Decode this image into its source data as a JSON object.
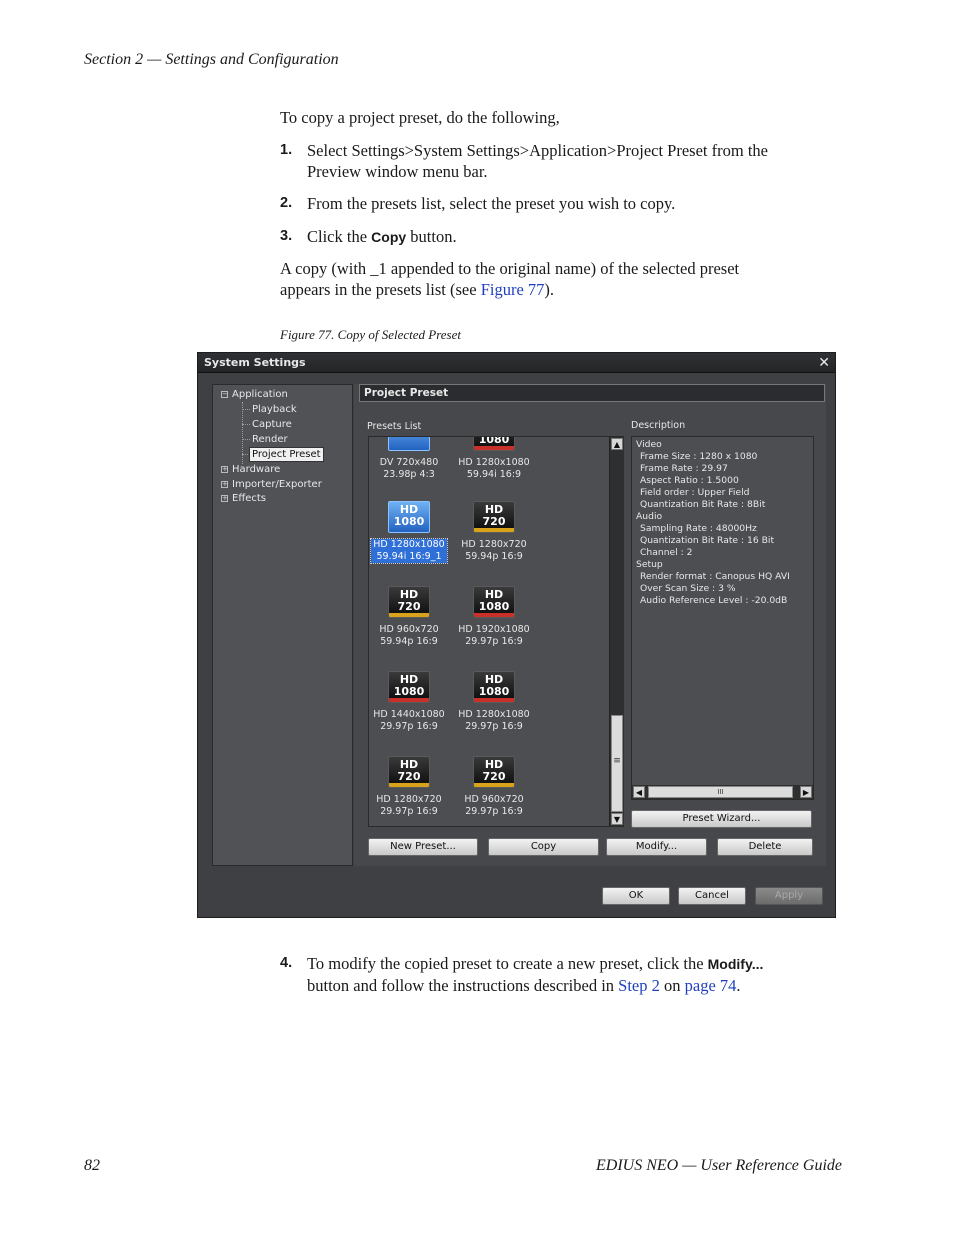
{
  "header": {
    "section": "Section 2 — Settings and Configuration"
  },
  "intro": "To copy a project preset, do the following,",
  "steps": [
    {
      "num": "1.",
      "line1": "Select Settings>System Settings>Application>Project Preset from the",
      "line2": "Preview window menu bar."
    },
    {
      "num": "2.",
      "line1": "From the presets list, select the preset you wish to copy."
    },
    {
      "num": "3.",
      "pre": "Click the ",
      "ui": "Copy",
      "post": " button."
    }
  ],
  "result": {
    "line1": "A copy (with _1 appended to the original name) of the selected preset",
    "line2_pre": "appears in the presets list (see ",
    "line2_link": "Figure 77",
    "line2_post": ")."
  },
  "figure_caption": "Figure 77.  Copy of Selected Preset",
  "dialog": {
    "title": "System Settings",
    "close": "✕",
    "tree": {
      "application": "Application",
      "children": [
        "Playback",
        "Capture",
        "Render",
        "Project Preset"
      ],
      "others": [
        "Hardware",
        "Importer/Exporter",
        "Effects"
      ],
      "collapse_glyph": "−",
      "expand_glyph": "+"
    },
    "panel_title": "Project  Preset",
    "presets_label": "Presets List",
    "description_label": "Description",
    "presets": [
      {
        "line1": "DV 720x480",
        "line2": "23.98p 4:3",
        "ico_a": "",
        "ico_b": ""
      },
      {
        "line1": "HD 1280x1080",
        "line2": "59.94i 16:9",
        "ico_a": "",
        "ico_b": "1080"
      },
      {
        "line1": "HD 1280x1080",
        "line2": "59.94i 16:9_1",
        "ico_a": "HD",
        "ico_b": "1080"
      },
      {
        "line1": "HD 1280x720",
        "line2": "59.94p 16:9",
        "ico_a": "HD",
        "ico_b": "720"
      },
      {
        "line1": "HD 960x720",
        "line2": "59.94p 16:9",
        "ico_a": "HD",
        "ico_b": "720"
      },
      {
        "line1": "HD 1920x1080",
        "line2": "29.97p 16:9",
        "ico_a": "HD",
        "ico_b": "1080"
      },
      {
        "line1": "HD 1440x1080",
        "line2": "29.97p 16:9",
        "ico_a": "HD",
        "ico_b": "1080"
      },
      {
        "line1": "HD 1280x1080",
        "line2": "29.97p 16:9",
        "ico_a": "HD",
        "ico_b": "1080"
      },
      {
        "line1": "HD 1280x720",
        "line2": "29.97p 16:9",
        "ico_a": "HD",
        "ico_b": "720"
      },
      {
        "line1": "HD 960x720",
        "line2": "29.97p 16:9",
        "ico_a": "HD",
        "ico_b": "720"
      }
    ],
    "description": [
      "Video",
      "Frame Size : 1280 x 1080",
      "Frame Rate : 29.97",
      "Aspect Ratio : 1.5000",
      "Field order : Upper Field",
      "Quantization Bit Rate : 8Bit",
      "Audio",
      "Sampling Rate : 48000Hz",
      "Quantization Bit Rate : 16 Bit",
      "Channel : 2",
      "Setup",
      "Render format : Canopus HQ AVI",
      "Over Scan Size : 3 %",
      "Audio Reference Level : -20.0dB"
    ],
    "scroll": {
      "up": "▲",
      "down": "▼",
      "left": "◀",
      "right": "▶",
      "grip_v": "≡",
      "grip_h": "III"
    },
    "buttons": {
      "preset_wizard": "Preset Wizard...",
      "new_preset": "New Preset...",
      "copy": "Copy",
      "modify": "Modify...",
      "delete": "Delete",
      "ok": "OK",
      "cancel": "Cancel",
      "apply": "Apply"
    }
  },
  "step4": {
    "num": "4.",
    "pre": "To modify the copied preset to create a new preset, click the ",
    "ui": "Modify...",
    "line2_pre": "button and follow the instructions described in ",
    "link1": "Step 2",
    "mid": " on ",
    "link2": "page 74",
    "post": "."
  },
  "footer": {
    "page": "82",
    "guide": "EDIUS NEO  —  User Reference Guide"
  },
  "colors": {
    "link": "#1f3fbf",
    "dialog_bg": "#3e4043",
    "selection": "#2f6fd8",
    "stripe_720": "#d9a21b",
    "stripe_1080": "#c8302a"
  }
}
